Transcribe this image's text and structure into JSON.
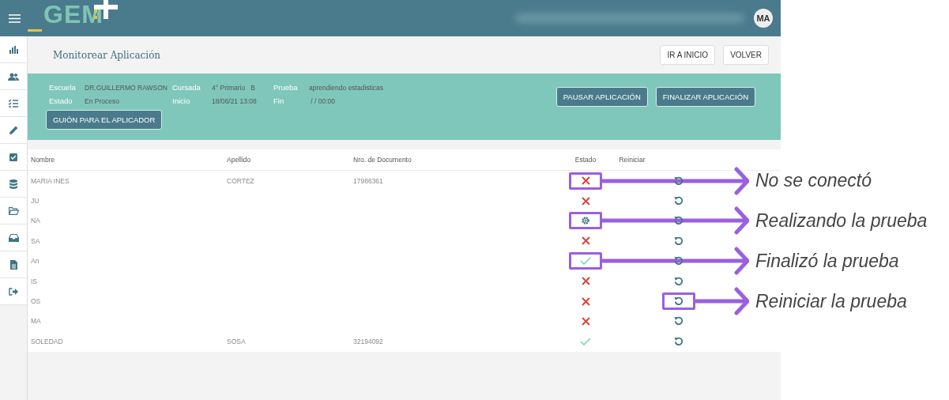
{
  "header": {
    "logo": "GEM",
    "avatar": "MA"
  },
  "page": {
    "title": "Monitorear Aplicación",
    "buttons": [
      "IR A INICIO",
      "VOLVER"
    ]
  },
  "info": {
    "fields": [
      {
        "label": "Escuela",
        "value": "DR.GUILLERMO RAWSON"
      },
      {
        "label": "Cursada",
        "value": "4° Primario   B"
      },
      {
        "label": "Prueba",
        "value": "aprendiendo estadisticas"
      },
      {
        "label": "Estado",
        "value": "En Proceso"
      },
      {
        "label": "Inicio",
        "value": "18/06/21 13:08"
      },
      {
        "label": "Fin",
        "value": " / / 00:00"
      }
    ],
    "script_button": "GUIÓN PARA EL APLICADOR",
    "actions": [
      "PAUSAR APLICACIÓN",
      "FINALIZAR APLICACIÓN"
    ]
  },
  "table": {
    "columns": [
      "Nombre",
      "Apellido",
      "Nro. de Documento",
      "Estado",
      "Reiniciar"
    ],
    "rows": [
      {
        "nombre": "MARIA INES",
        "apellido": "CORTEZ",
        "documento": "17986361",
        "kind": "not_connected",
        "estado_callout": "No se conectó"
      },
      {
        "nombre": "JU",
        "kind": "not_connected"
      },
      {
        "nombre": "NA",
        "kind": "in_progress",
        "estado_callout": "Realizando la prueba"
      },
      {
        "nombre": "SA",
        "kind": "not_connected"
      },
      {
        "nombre": "An",
        "kind": "finished",
        "estado_callout": "Finalizó la prueba"
      },
      {
        "nombre": "IS",
        "kind": "not_connected"
      },
      {
        "nombre": "OS",
        "kind": "not_connected",
        "reiniciar_callout": "Reiniciar la prueba"
      },
      {
        "nombre": "MA",
        "kind": "not_connected"
      },
      {
        "nombre": "SOLEDAD",
        "apellido": "SOSA",
        "documento": "32194092",
        "kind": "finished"
      }
    ]
  }
}
